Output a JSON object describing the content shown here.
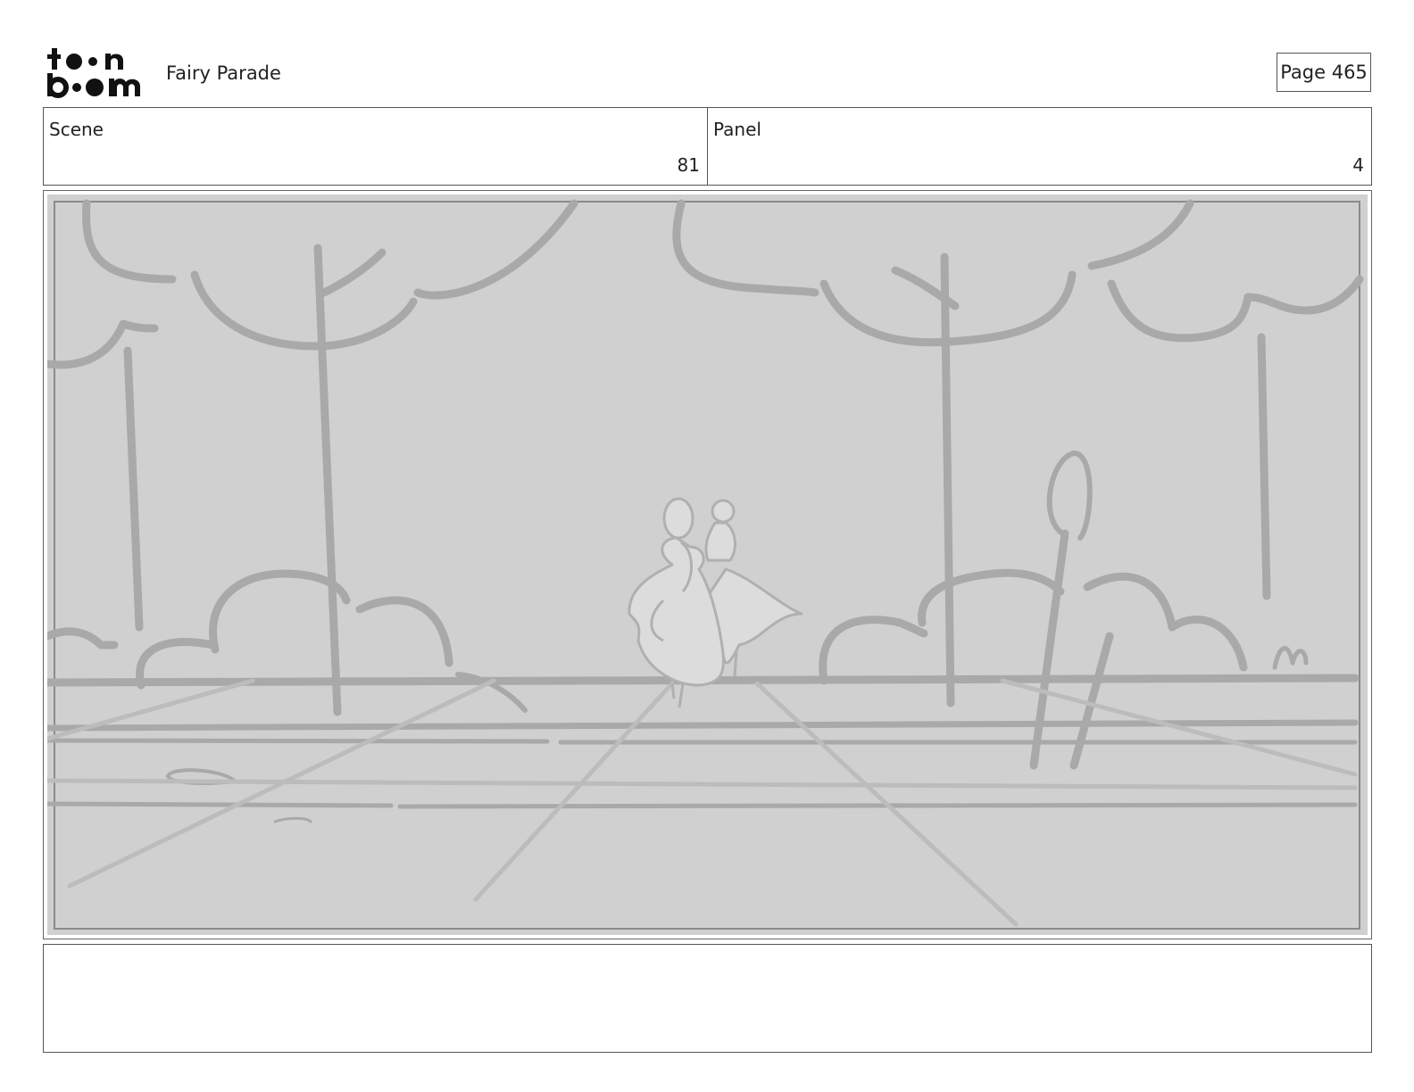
{
  "header": {
    "logo_text": "toonboom",
    "project_title": "Fairy Parade",
    "page_label": "Page 465"
  },
  "scene": {
    "label": "Scene",
    "value": "81"
  },
  "panel": {
    "label": "Panel",
    "value": "4"
  },
  "sketch": {
    "description_colors": {
      "background": "#d0d0d0",
      "stroke": "#a8a8a8",
      "light_stroke": "#bdbdbd",
      "figure": "#dedede"
    }
  },
  "notes": {
    "text": ""
  }
}
